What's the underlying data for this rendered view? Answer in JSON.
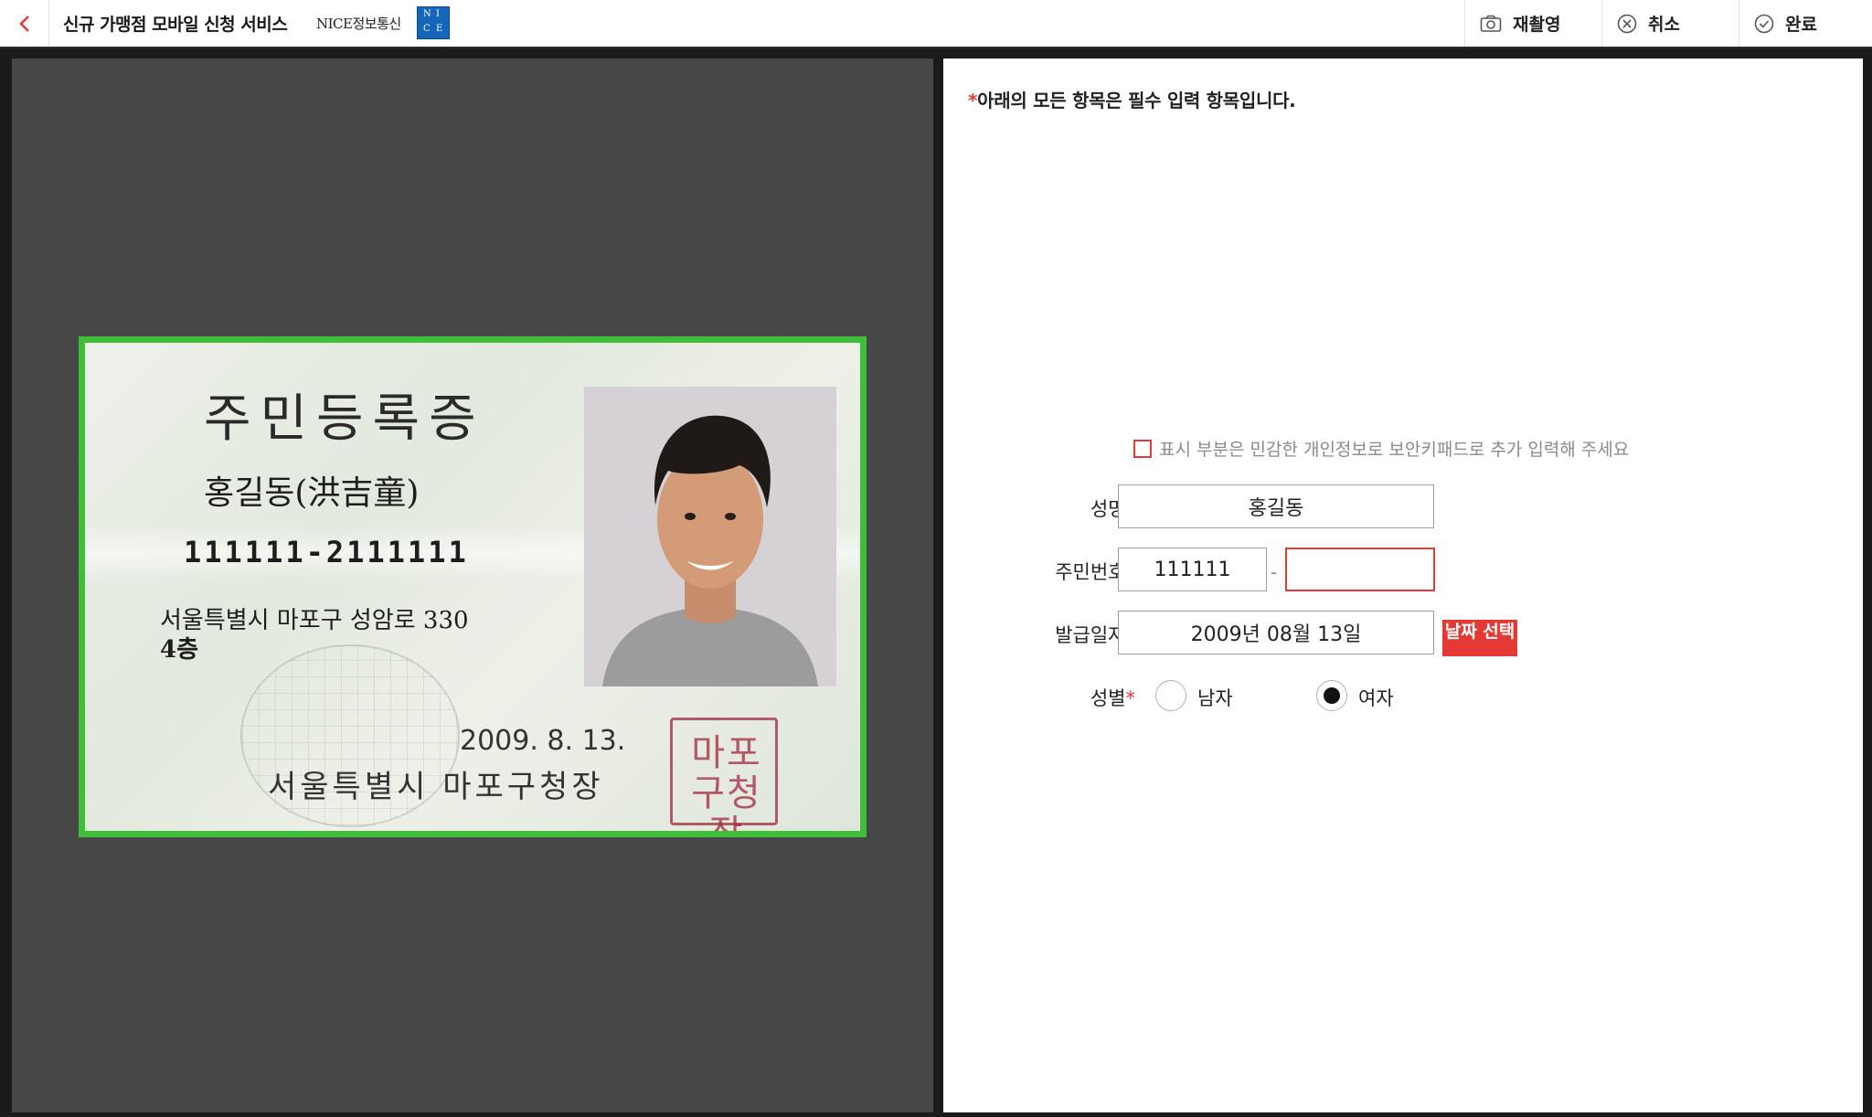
{
  "header": {
    "title": "신규 가맹점 모바일 신청 서비스",
    "brand_text": "NICE정보통신",
    "brand_logo_letters": [
      "N",
      "I",
      "C",
      "E"
    ],
    "actions": [
      {
        "label": "재촬영",
        "icon": "camera-icon"
      },
      {
        "label": "취소",
        "icon": "cancel-circle-icon"
      },
      {
        "label": "완료",
        "icon": "check-circle-icon"
      }
    ]
  },
  "id_card": {
    "title": "주민등록증",
    "name": "홍길동(洪吉童)",
    "rrn": "111111-2111111",
    "address_line1": "서울특별시 마포구 성암로 330",
    "address_line2": "4층",
    "issue_date": "2009. 8. 13.",
    "issuer": "서울특별시 마포구청장",
    "seal_text": "마포구청장"
  },
  "form": {
    "notice_mark": "*",
    "notice": "아래의 모든 항목은 필수 입력 항목입니다.",
    "hint": "표시 부분은 민감한 개인정보로 보안키패드로 추가 입력해 주세요",
    "required_mark": "*",
    "name": {
      "label": "성명",
      "value": "홍길동"
    },
    "rrn": {
      "label": "주민번호",
      "front": "111111",
      "separator": "-",
      "back": ""
    },
    "issue_date": {
      "label": "발급일자",
      "value": "2009년 08월 13일",
      "button": "날짜 선택"
    },
    "gender": {
      "label": "성별",
      "options": [
        "남자",
        "여자"
      ],
      "selected": "여자"
    }
  },
  "colors": {
    "accent_red": "#e53935",
    "card_frame_green": "#3fbe37",
    "panel_gray": "#474747"
  }
}
